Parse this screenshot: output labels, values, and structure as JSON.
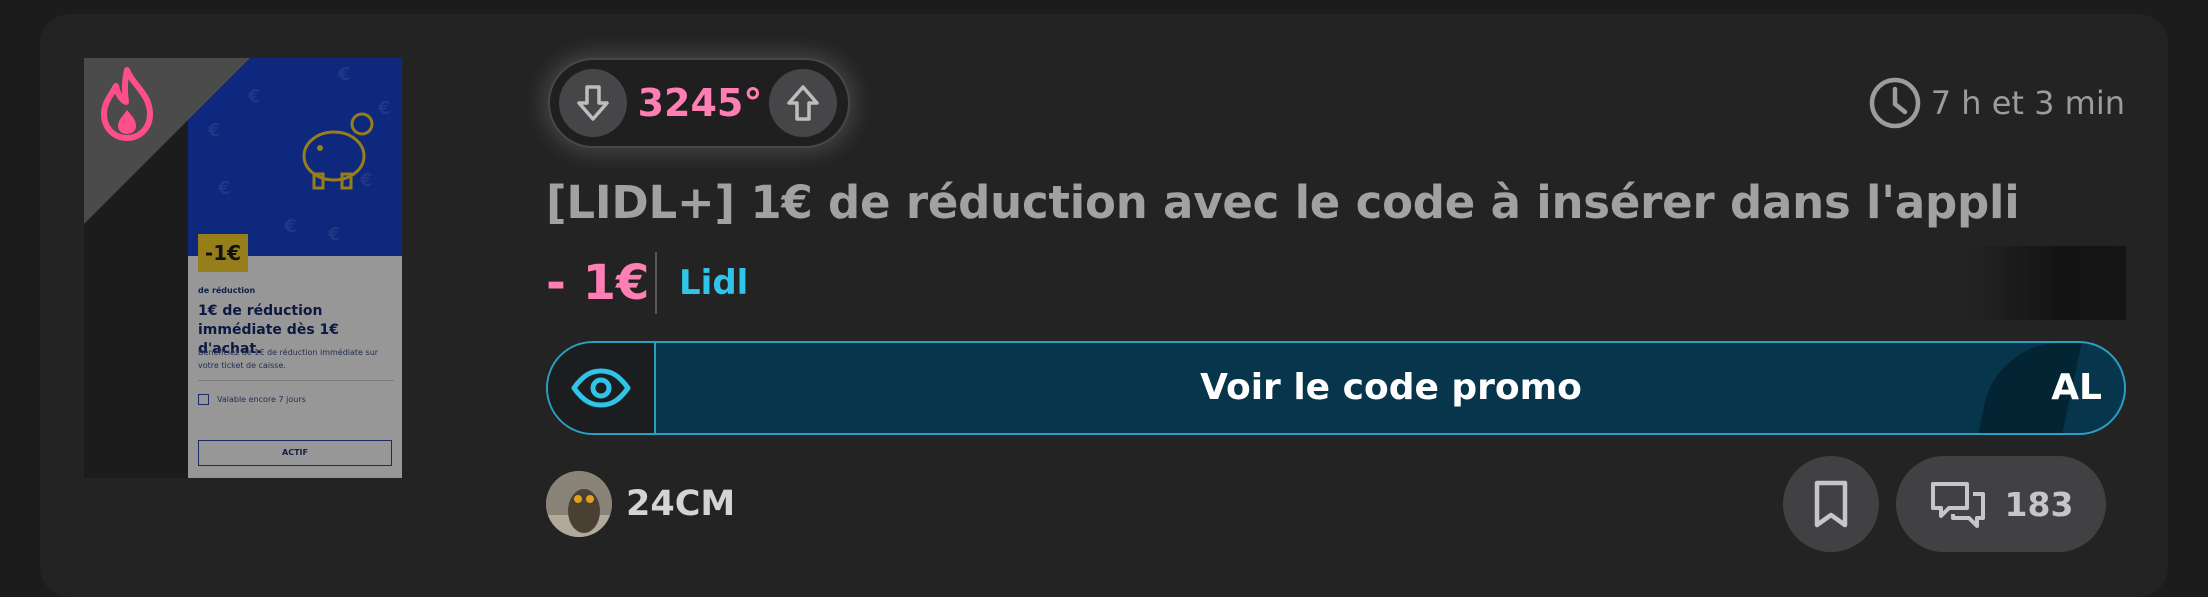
{
  "deal": {
    "temperature": "3245°",
    "posted_time": "7 h et 3 min",
    "title": "[LIDL+] 1€ de réduction avec le code à insérer dans l'appli",
    "price": "- 1€",
    "merchant": "Lidl",
    "promo_button_label": "Voir le code promo",
    "code_peek": "AL",
    "user_name": "24CM",
    "comment_count": "183"
  },
  "thumbnail": {
    "badge": "-1€",
    "small_label": "de réduction",
    "headline": "1€ de réduction immédiate dès 1€ d'achat.",
    "description": "Bénéficiez de 1€ de réduction immédiate sur votre ticket de caisse.",
    "validity": "Valable encore 7 jours",
    "button": "ACTIF"
  },
  "icons": {
    "hot": "flame-icon",
    "vote_down": "arrow-down-icon",
    "vote_up": "arrow-up-icon",
    "time": "clock-icon",
    "reveal": "eye-icon",
    "bookmark": "bookmark-icon",
    "comments": "comments-icon"
  },
  "colors": {
    "temperature": "#ff7eb4",
    "price": "#ff7eb4",
    "merchant": "#2fc4e8",
    "promo_background": "#06354c",
    "promo_border": "#2a9fc2",
    "hot_flame": "#ff4f8b"
  }
}
